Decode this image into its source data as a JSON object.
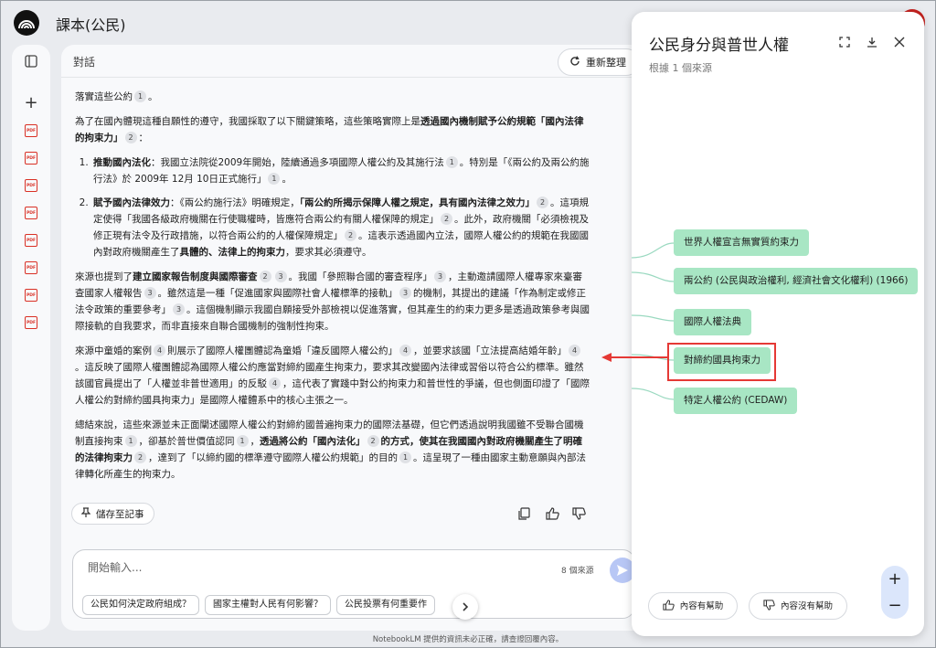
{
  "app": {
    "title": "課本(公民)"
  },
  "rail": {
    "add_label": "+",
    "pdf_label": "PDF"
  },
  "chat": {
    "header_title": "對話",
    "reorganize_label": "重新整理",
    "p0": {
      "t1": "落實這些公約",
      "c1": "1",
      "t2": "。"
    },
    "p1": {
      "t1": "為了在國內體現這種自願性的遵守，我國採取了以下關鍵策略，這些策略實際上是",
      "b1": "透過國內機制賦予公約規範「國內法律的拘束力」",
      "c1": "2",
      "t2": "："
    },
    "li1": {
      "b1": "推動國內法化",
      "t1": "：我國立法院從2009年開始，陸續通過多項國際人權公約及其施行法",
      "c1": "1",
      "t2": "。特別是「《兩公約及兩公約施行法》於 2009年 12月 10日正式施行」",
      "c2": "1",
      "t3": "。"
    },
    "li2": {
      "b1": "賦予國內法律效力",
      "t1": "：《兩公約施行法》明確規定，",
      "b2": "「兩公約所揭示保障人權之規定，具有國內法律之效力」",
      "c1": "2",
      "t2": "。這項規定使得「我國各級政府機關在行使職權時，皆應符合兩公約有關人權保障的規定」",
      "c2": "2",
      "t3": "。此外，政府機關「必須檢視及修正現有法令及行政措施，以符合兩公約的人權保障規定」",
      "c3": "2",
      "t4": "。這表示透過國內立法，國際人權公約的規範在我國國內對政府機關產生了",
      "b3": "具體的、法律上的拘束力",
      "t5": "，要求其必須遵守。"
    },
    "p2": {
      "t1": "來源也提到了",
      "b1": "建立國家報告制度與國際審查",
      "c1": "2",
      "c2": "3",
      "t2": "。我國「參照聯合國的審查程序」",
      "c3": "3",
      "t3": "，主動邀請國際人權專家來臺審查國家人權報告",
      "c4": "3",
      "t4": "。雖然這是一種「促進國家與國際社會人權標準的接軌」",
      "c5": "3",
      "t5": "的機制，其提出的建議「作為制定或修正法令政策的重要參考」",
      "c6": "3",
      "t6": "。這個機制顯示我國自願接受外部檢視以促進落實，但其產生的約束力更多是透過政策參考與國際接軌的自我要求，而非直接來自聯合國機制的強制性拘束。"
    },
    "p3": {
      "t1": "來源中童婚的案例",
      "c1": "4",
      "t2": "則展示了國際人權團體認為童婚「違反國際人權公約」",
      "c2": "4",
      "t3": "，並要求該國「立法提高結婚年齡」",
      "c3": "4",
      "t4": "。這反映了國際人權團體認為國際人權公約應當對締約國產生拘束力，要求其改變國內法律或習俗以符合公約標準。雖然該國官員提出了「人權並非普世適用」的反駁",
      "c4": "4",
      "t5": "，這代表了實踐中對公約拘束力和普世性的爭議，但也側面印證了「國際人權公約對締約國具拘束力」是國際人權體系中的核心主張之一。"
    },
    "p4": {
      "t1": "總結來說，這些來源並未正面闡述國際人權公約對締約國普遍拘束力的國際法基礎，但它們透過說明我國雖不受聯合國機制直接拘束",
      "c1": "1",
      "t2": "，卻基於普世價值認同",
      "c2": "1",
      "t3": "，",
      "b1": "透過將公約「國內法化」",
      "c3": "2",
      "b2": "的方式，使其在我國國內對政府機關產生了明確的法律拘束力",
      "c4": "2",
      "t4": "，達到了「以締約國的標準遵守國際人權公約規範」的目的",
      "c5": "1",
      "t5": "。這呈現了一種由國家主動意願與內部法律轉化所產生的拘束力。"
    },
    "save_note_label": "儲存至記事",
    "input": {
      "placeholder": "開始輸入...",
      "source_count": "8 個來源"
    },
    "chips": [
      "公民如何決定政府組成？",
      "國家主權對人民有何影響？",
      "公民投票有何重要作"
    ]
  },
  "footer": {
    "note": "NotebookLM 提供的資訊未必正確，請查證回覆內容。"
  },
  "panel": {
    "title": "公民身分與普世人權",
    "subtitle": "根據 1 個來源",
    "nodes": [
      "世界人權宣言無實質約束力",
      "兩公約 (公民與政治權利, 經濟社會文化權利) (1966)",
      "國際人權法典",
      "對締約國具拘束力",
      "特定人權公約 (CEDAW)"
    ],
    "zoom_in_label": "+",
    "zoom_out_label": "−",
    "helpful_label": "內容有幫助",
    "not_helpful_label": "內容沒有幫助"
  },
  "colors": {
    "node": "#a8e6c4",
    "highlight": "#e53935",
    "send": "#b8c7f5"
  }
}
